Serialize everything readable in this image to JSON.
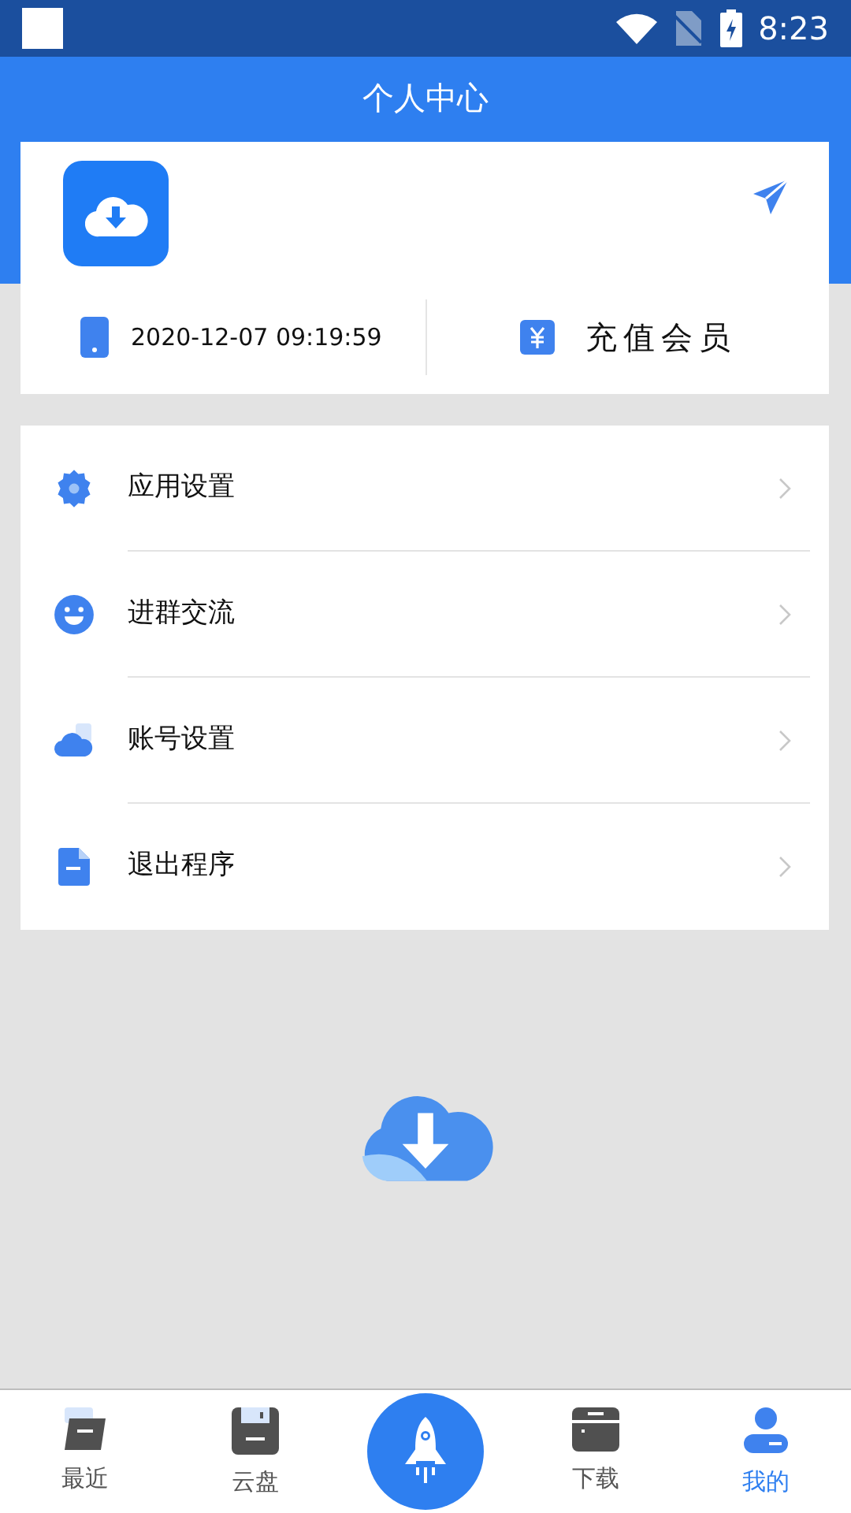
{
  "status_bar": {
    "time": "8:23"
  },
  "header": {
    "title": "个人中心"
  },
  "profile": {
    "login_time": "2020-12-07 09:19:59",
    "vip_button": "充值会员"
  },
  "menu": [
    {
      "label": "应用设置"
    },
    {
      "label": "进群交流"
    },
    {
      "label": "账号设置"
    },
    {
      "label": "退出程序"
    }
  ],
  "bottom_nav": [
    {
      "label": "最近",
      "selected": false
    },
    {
      "label": "云盘",
      "selected": false
    },
    {
      "label": "下载",
      "selected": false
    },
    {
      "label": "我的",
      "selected": true
    }
  ]
}
